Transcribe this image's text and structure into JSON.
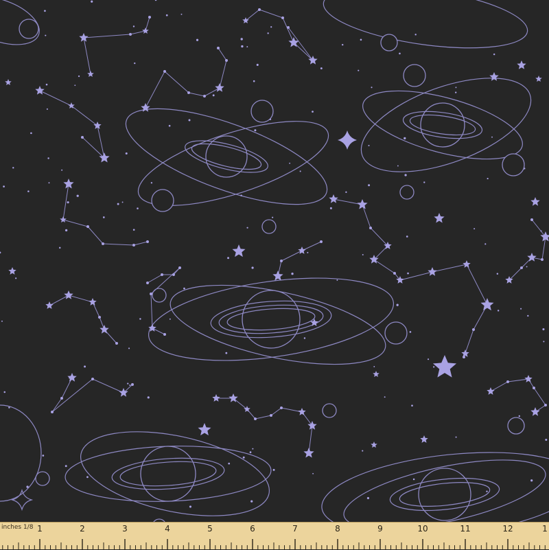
{
  "colors": {
    "fabric_background": "#262626",
    "line_art": "#8e89c4",
    "star_fill": "#a9a2e3",
    "ruler_background": "#ecd49c",
    "ruler_ink": "#2a2418"
  },
  "motifs": [
    "planet-with-rings",
    "orbit-ellipse",
    "constellation",
    "star",
    "four-point-star"
  ],
  "ruler": {
    "unit_label": "inches 1/8",
    "numbers": [
      "1",
      "2",
      "3",
      "4",
      "5",
      "6",
      "7",
      "8",
      "9",
      "10",
      "11",
      "12",
      "1"
    ]
  }
}
